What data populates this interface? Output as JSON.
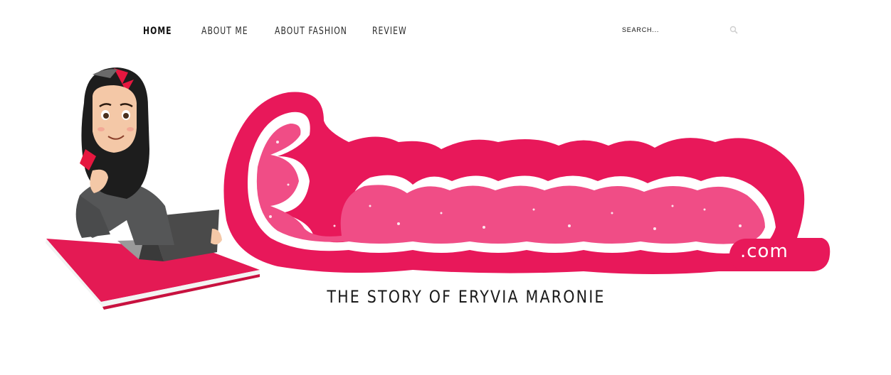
{
  "nav": {
    "items": [
      {
        "label": "HOME",
        "active": true
      },
      {
        "label": "ABOUT ME",
        "active": false
      },
      {
        "label": "ABOUT FASHION",
        "active": false
      },
      {
        "label": "REVIEW",
        "active": false
      }
    ]
  },
  "search": {
    "placeholder": "SEARCH...",
    "value": "",
    "icon": "search-icon"
  },
  "logo": {
    "wordmark": "Emaronie",
    "domain": ".com",
    "tagline": "THE STORY OF ERYVIA MARONIE"
  },
  "colors": {
    "brand_pink": "#e8185a",
    "light_pink": "#f04d86",
    "dark": "#1a1a1a",
    "book_red": "#e41a54"
  }
}
